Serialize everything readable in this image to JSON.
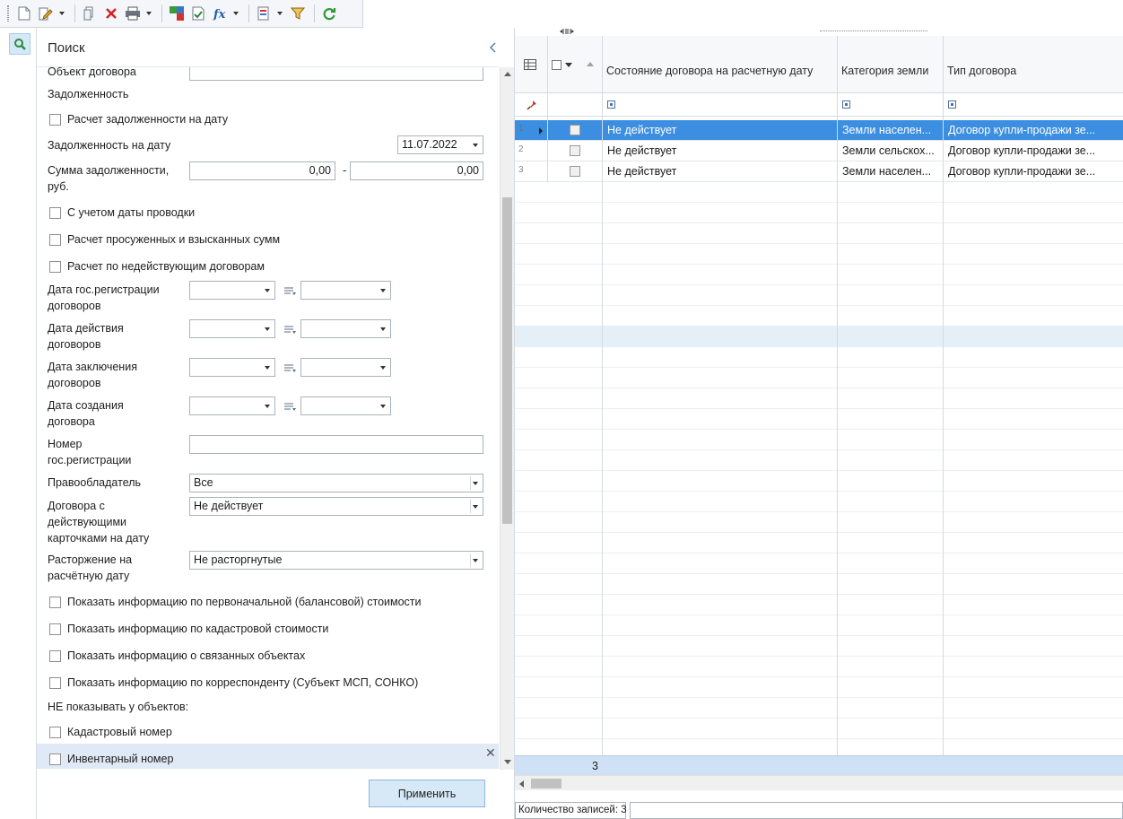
{
  "search_panel": {
    "title": "Поиск",
    "fields": {
      "object_label": "Объект договора",
      "debt_section": "Задолженность",
      "debt_calc_checkbox": "Расчет задолженности на дату",
      "debt_date_label": "Задолженность на дату",
      "debt_date_value": "11.07.2022",
      "debt_sum_label_1": "Сумма задолженности,",
      "debt_sum_label_2": "руб.",
      "debt_sum_from": "0,00",
      "debt_sum_dash": "-",
      "debt_sum_to": "0,00",
      "posting_date_checkbox": "С учетом даты проводки",
      "overdue_checkbox": "Расчет просуженных и взысканных сумм",
      "inactive_checkbox": "Расчет по недействующим договорам",
      "reg_date_label_1": "Дата гос.регистрации",
      "reg_date_label_2": "договоров",
      "valid_date_label_1": "Дата действия",
      "valid_date_label_2": "договоров",
      "conclusion_date_label_1": "Дата заключения",
      "conclusion_date_label_2": "договоров",
      "create_date_label_1": "Дата создания",
      "create_date_label_2": "договора",
      "reg_number_label_1": "Номер",
      "reg_number_label_2": "гос.регистрации",
      "holder_label": "Правообладатель",
      "holder_value": "Все",
      "active_cards_label_1": "Договора с",
      "active_cards_label_2": "действующими",
      "active_cards_label_3": "карточками на дату",
      "active_cards_value": "Не действует",
      "termination_label_1": "Расторжение на",
      "termination_label_2": "расчётную дату",
      "termination_value": "Не расторгнутые",
      "show_initial_cost": "Показать информацию по первоначальной (балансовой) стоимости",
      "show_cadastral_cost": "Показать информацию по кадастровой стоимости",
      "show_related": "Показать информацию о связанных объектах",
      "show_correspondent": "Показать информацию по корреспонденту (Субъект МСП, СОНКО)",
      "hide_section": "НЕ показывать у объектов:",
      "hide_cadastral": "Кадастровый номер",
      "hide_inventory": "Инвентарный номер"
    },
    "apply_label": "Применить"
  },
  "grid": {
    "columns": [
      "Состояние договора на расчетную дату",
      "Категория земли",
      "Тип договора"
    ],
    "rows": [
      {
        "n": "1",
        "state": "Не действует",
        "category": "Земли населен...",
        "type": "Договор купли-продажи зе..."
      },
      {
        "n": "2",
        "state": "Не действует",
        "category": "Земли сельскох...",
        "type": "Договор купли-продажи зе..."
      },
      {
        "n": "3",
        "state": "Не действует",
        "category": "Земли населен...",
        "type": "Договор купли-продажи зе..."
      }
    ],
    "total": "3",
    "status": "Количество записей: 3"
  },
  "colors": {
    "selected_row": "#3c8ee0",
    "apply_button": "#d7e8f7",
    "toolbar": "#f4f6f9"
  }
}
